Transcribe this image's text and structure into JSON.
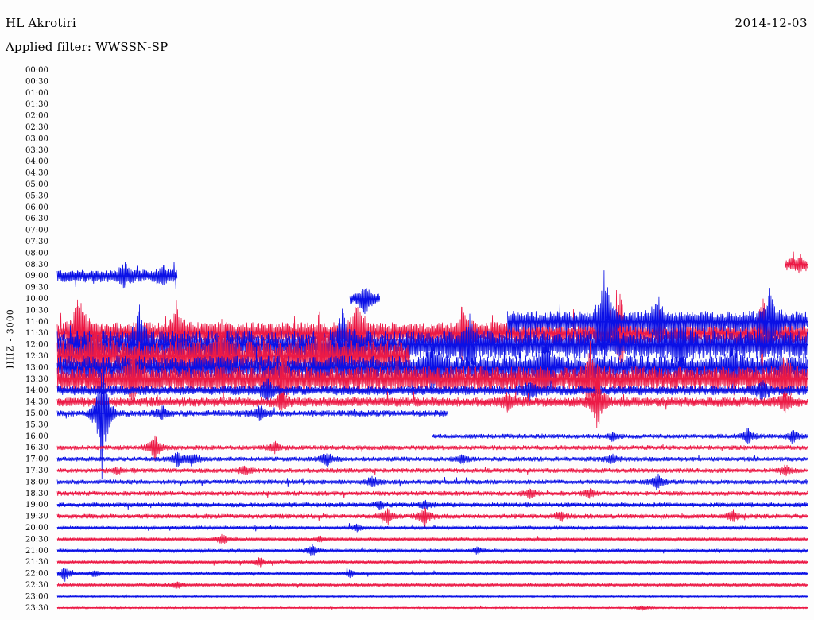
{
  "header": {
    "station": "HL Akrotiri",
    "date": "2014-12-03",
    "filter_label": "Applied filter: WWSSN-SP"
  },
  "axis": {
    "ylabel": "HHZ - 3000"
  },
  "colors": {
    "blue": "#0a10e6",
    "red": "#ec1a46",
    "background": "#fdfdfd"
  },
  "chart_data": {
    "type": "line",
    "title": "HL Akrotiri",
    "subtitle": "Applied filter: WWSSN-SP",
    "ylabel": "HHZ - 3000",
    "grid": false,
    "legend": "none",
    "row_labels": [
      "00:00",
      "00:30",
      "01:00",
      "01:30",
      "02:00",
      "02:30",
      "03:00",
      "03:30",
      "04:00",
      "04:30",
      "05:00",
      "05:30",
      "06:00",
      "06:30",
      "07:00",
      "07:30",
      "08:00",
      "08:30",
      "09:00",
      "09:30",
      "10:00",
      "10:30",
      "11:00",
      "11:30",
      "12:00",
      "12:30",
      "13:00",
      "13:30",
      "14:00",
      "14:30",
      "15:00",
      "15:30",
      "16:00",
      "16:30",
      "17:00",
      "17:30",
      "18:00",
      "18:30",
      "19:00",
      "19:30",
      "20:00",
      "20:30",
      "21:00",
      "21:30",
      "22:00",
      "22:30",
      "23:00",
      "23:30"
    ],
    "series": [
      {
        "label": "09:00",
        "color": "blue",
        "start": 0.0,
        "end": 0.16,
        "amplitude": 8,
        "events": [
          [
            0.09,
            14
          ],
          [
            0.14,
            10
          ]
        ]
      },
      {
        "label": "10:00",
        "color": "blue",
        "start": 0.39,
        "end": 0.43,
        "amplitude": 6,
        "events": [
          [
            0.41,
            20
          ]
        ]
      },
      {
        "label": "08:30",
        "color": "red",
        "start": 0.97,
        "end": 1.0,
        "amplitude": 7,
        "events": [
          [
            0.99,
            10
          ]
        ]
      },
      {
        "label": "11:30",
        "color": "red",
        "start": 0.0,
        "end": 1.0,
        "amplitude": 14,
        "events": [
          [
            0.03,
            60
          ],
          [
            0.16,
            40
          ],
          [
            0.4,
            55
          ],
          [
            0.54,
            30
          ],
          [
            0.75,
            50
          ],
          [
            0.94,
            45
          ]
        ]
      },
      {
        "label": "11:00",
        "color": "blue",
        "start": 0.6,
        "end": 1.0,
        "amplitude": 14,
        "events": [
          [
            0.73,
            70
          ],
          [
            0.8,
            25
          ],
          [
            0.95,
            40
          ]
        ]
      },
      {
        "label": "12:00",
        "color": "blue",
        "start": 0.0,
        "end": 1.0,
        "amplitude": 18,
        "events": [
          [
            0.11,
            50
          ],
          [
            0.38,
            45
          ],
          [
            0.55,
            30
          ],
          [
            0.83,
            28
          ]
        ]
      },
      {
        "label": "12:30",
        "color": "red",
        "start": 0.0,
        "end": 0.47,
        "amplitude": 20,
        "events": [
          [
            0.05,
            40
          ],
          [
            0.22,
            50
          ],
          [
            0.35,
            55
          ]
        ]
      },
      {
        "label": "13:00",
        "color": "blue",
        "start": 0.0,
        "end": 1.0,
        "amplitude": 15,
        "events": [
          [
            0.5,
            30
          ],
          [
            0.65,
            40
          ],
          [
            0.9,
            25
          ]
        ]
      },
      {
        "label": "13:30",
        "color": "red",
        "start": 0.0,
        "end": 1.0,
        "amplitude": 16,
        "events": [
          [
            0.1,
            30
          ],
          [
            0.3,
            28
          ],
          [
            0.71,
            35
          ],
          [
            0.97,
            22
          ]
        ]
      },
      {
        "label": "14:00",
        "color": "blue",
        "start": 0.0,
        "end": 1.0,
        "amplitude": 6,
        "events": [
          [
            0.28,
            15
          ],
          [
            0.63,
            12
          ],
          [
            0.94,
            14
          ]
        ]
      },
      {
        "label": "14:30",
        "color": "red",
        "start": 0.0,
        "end": 1.0,
        "amplitude": 6,
        "events": [
          [
            0.3,
            12
          ],
          [
            0.6,
            10
          ],
          [
            0.72,
            40
          ],
          [
            0.97,
            14
          ]
        ]
      },
      {
        "label": "15:00",
        "color": "blue",
        "start": 0.0,
        "end": 0.52,
        "amplitude": 4,
        "events": [
          [
            0.14,
            8
          ],
          [
            0.27,
            10
          ],
          [
            0.06,
            90
          ]
        ]
      },
      {
        "label": "16:00",
        "color": "blue",
        "start": 0.5,
        "end": 1.0,
        "amplitude": 3,
        "events": [
          [
            0.74,
            6
          ],
          [
            0.92,
            10
          ],
          [
            0.98,
            9
          ]
        ]
      },
      {
        "label": "16:30",
        "color": "red",
        "start": 0.0,
        "end": 1.0,
        "amplitude": 3,
        "events": [
          [
            0.13,
            18
          ],
          [
            0.29,
            8
          ]
        ]
      },
      {
        "label": "17:00",
        "color": "blue",
        "start": 0.0,
        "end": 1.0,
        "amplitude": 3,
        "events": [
          [
            0.16,
            10
          ],
          [
            0.18,
            9
          ],
          [
            0.36,
            12
          ],
          [
            0.54,
            6
          ],
          [
            0.74,
            6
          ]
        ]
      },
      {
        "label": "17:30",
        "color": "red",
        "start": 0.0,
        "end": 1.0,
        "amplitude": 3,
        "events": [
          [
            0.08,
            5
          ],
          [
            0.25,
            6
          ],
          [
            0.97,
            7
          ]
        ]
      },
      {
        "label": "18:00",
        "color": "blue",
        "start": 0.0,
        "end": 1.0,
        "amplitude": 3,
        "events": [
          [
            0.42,
            9
          ],
          [
            0.8,
            12
          ]
        ]
      },
      {
        "label": "18:30",
        "color": "red",
        "start": 0.0,
        "end": 1.0,
        "amplitude": 3,
        "events": [
          [
            0.63,
            7
          ],
          [
            0.71,
            6
          ]
        ]
      },
      {
        "label": "19:00",
        "color": "blue",
        "start": 0.0,
        "end": 1.0,
        "amplitude": 3,
        "events": [
          [
            0.43,
            5
          ],
          [
            0.49,
            6
          ]
        ]
      },
      {
        "label": "19:30",
        "color": "red",
        "start": 0.0,
        "end": 1.0,
        "amplitude": 3,
        "events": [
          [
            0.44,
            10
          ],
          [
            0.49,
            14
          ],
          [
            0.67,
            6
          ],
          [
            0.9,
            8
          ]
        ]
      },
      {
        "label": "20:00",
        "color": "blue",
        "start": 0.0,
        "end": 1.0,
        "amplitude": 2,
        "events": [
          [
            0.4,
            5
          ]
        ]
      },
      {
        "label": "20:30",
        "color": "red",
        "start": 0.0,
        "end": 1.0,
        "amplitude": 2,
        "events": [
          [
            0.22,
            8
          ],
          [
            0.35,
            4
          ]
        ]
      },
      {
        "label": "21:00",
        "color": "blue",
        "start": 0.0,
        "end": 1.0,
        "amplitude": 2,
        "events": [
          [
            0.34,
            8
          ],
          [
            0.56,
            5
          ]
        ]
      },
      {
        "label": "21:30",
        "color": "red",
        "start": 0.0,
        "end": 1.0,
        "amplitude": 2,
        "events": [
          [
            0.27,
            6
          ]
        ]
      },
      {
        "label": "22:00",
        "color": "blue",
        "start": 0.0,
        "end": 1.0,
        "amplitude": 2,
        "events": [
          [
            0.01,
            10
          ],
          [
            0.05,
            5
          ],
          [
            0.39,
            5
          ]
        ]
      },
      {
        "label": "22:30",
        "color": "red",
        "start": 0.0,
        "end": 1.0,
        "amplitude": 2,
        "events": [
          [
            0.16,
            5
          ]
        ]
      },
      {
        "label": "23:00",
        "color": "blue",
        "start": 0.0,
        "end": 1.0,
        "amplitude": 1,
        "events": []
      },
      {
        "label": "23:30",
        "color": "red",
        "start": 0.0,
        "end": 1.0,
        "amplitude": 1,
        "events": [
          [
            0.78,
            4
          ]
        ]
      }
    ]
  }
}
